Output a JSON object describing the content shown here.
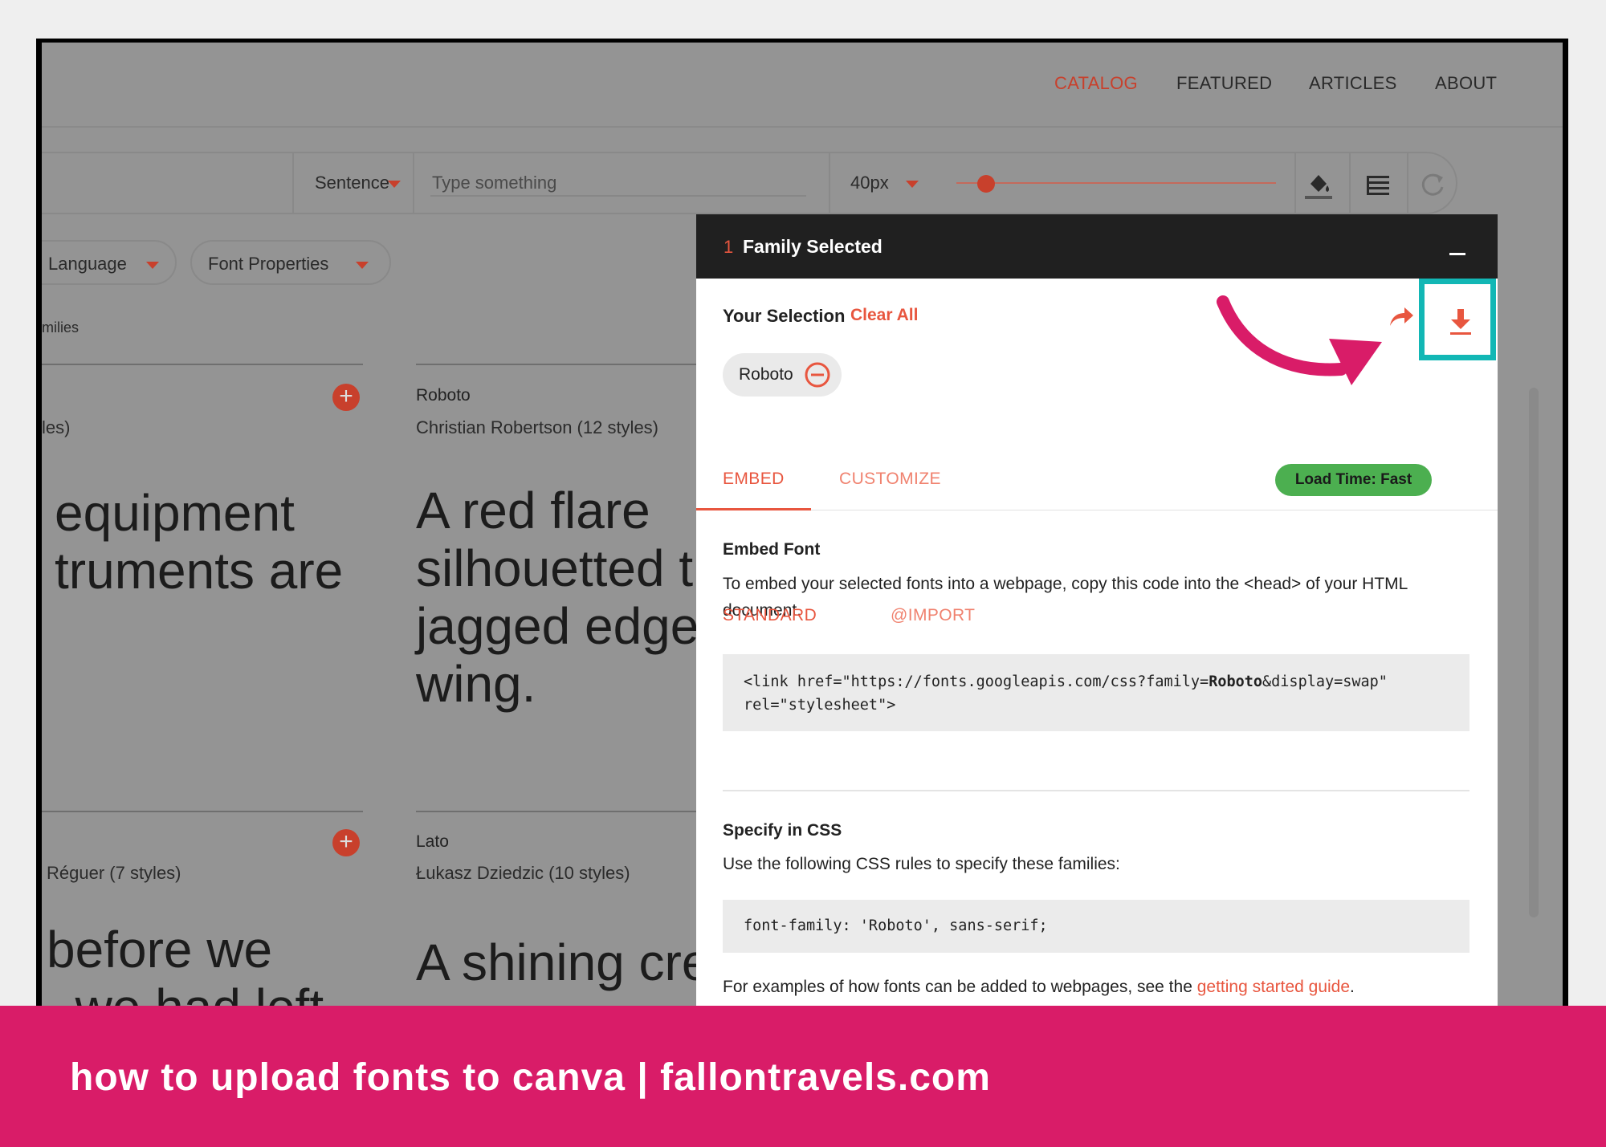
{
  "nav": {
    "items": [
      "CATALOG",
      "FEATURED",
      "ARTICLES",
      "ABOUT"
    ],
    "active": "CATALOG"
  },
  "toolbar": {
    "preview_mode": "Sentence",
    "input_placeholder": "Type something",
    "size": "40px"
  },
  "filters": {
    "language": "Language",
    "font_properties": "Font Properties",
    "families_fragment": "milies"
  },
  "cards": [
    {
      "name": "",
      "meta": "les)",
      "sample": "equipment\ntruments are"
    },
    {
      "name": "Roboto",
      "meta": "Christian Robertson (12 styles)",
      "sample": "A red flare\nsilhouetted t\njagged edge\nwing."
    },
    {
      "name": "",
      "meta": "Réguer (7 styles)",
      "sample": "before we\n  we had left"
    },
    {
      "name": "Lato",
      "meta": "Łukasz Dziedzic (10 styles)",
      "sample": "A shining cre\n  "
    }
  ],
  "panel": {
    "count": "1",
    "title": "Family Selected",
    "your_selection": "Your Selection",
    "clear_all": "Clear All",
    "selected_family": "Roboto",
    "tabs": {
      "embed": "EMBED",
      "customize": "CUSTOMIZE"
    },
    "load_time": "Load Time: Fast",
    "embed_heading": "Embed Font",
    "embed_text": "To embed your selected fonts into a webpage, copy this code into the <head> of your HTML document.",
    "subtabs": {
      "standard": "STANDARD",
      "import": "@IMPORT"
    },
    "code_line1_pre": "<link href=\"https://fonts.googleapis.com/css?family=",
    "code_line1_bold": "Roboto",
    "code_line1_post": "&display=swap\"",
    "code_line2": "rel=\"stylesheet\">",
    "css_heading": "Specify in CSS",
    "css_text": "Use the following CSS rules to specify these families:",
    "css_code": "font-family: 'Roboto', sans-serif;",
    "examples_pre": "For examples of how fonts can be added to webpages, see the ",
    "examples_link": "getting started guide",
    "examples_post": "."
  },
  "banner": {
    "text": "how to upload fonts to canva | fallontravels.com"
  },
  "colors": {
    "accent": "#e8563f",
    "highlight_box": "#12b7b5",
    "arrow": "#d91c68",
    "badge": "#4caf50",
    "banner": "#d91c68"
  },
  "icons": [
    "paint-bucket-icon",
    "list-icon",
    "refresh-icon",
    "share-icon",
    "download-icon",
    "remove-circle-icon",
    "plus-icon",
    "minimize-icon"
  ]
}
